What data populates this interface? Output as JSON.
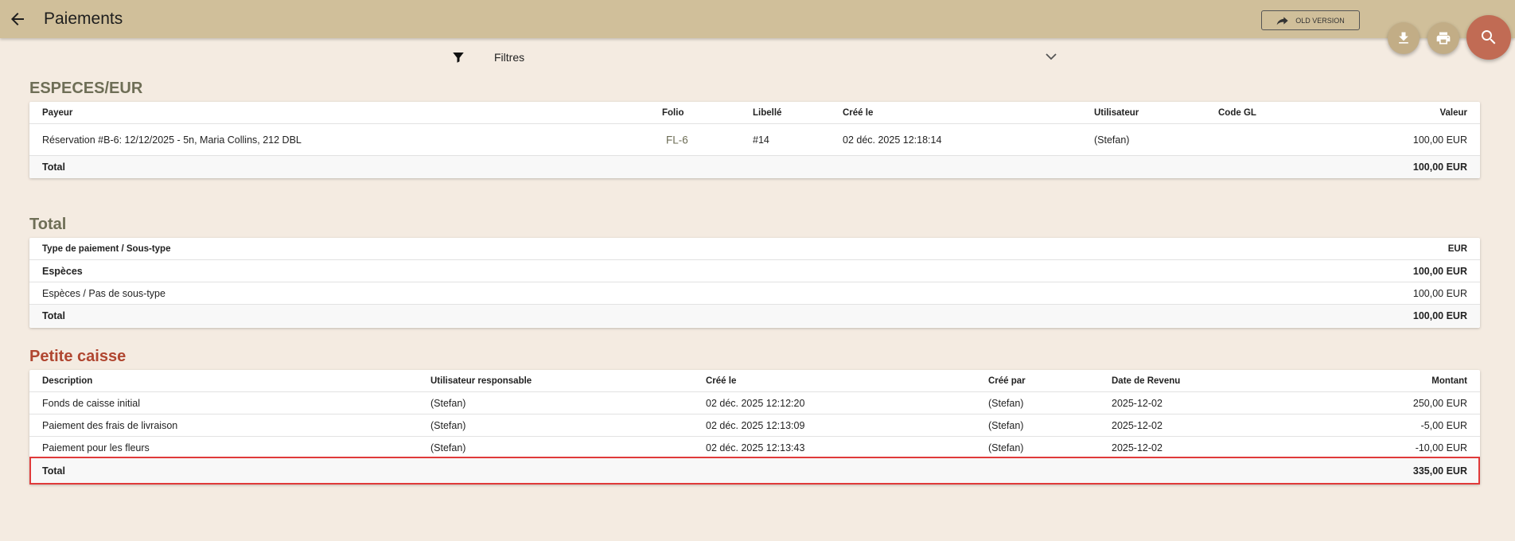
{
  "header": {
    "title": "Paiements",
    "old_version_label": "OLD VERSION"
  },
  "filter": {
    "label": "Filtres"
  },
  "especes_section": {
    "title": "ESPECES/EUR",
    "columns": {
      "payeur": "Payeur",
      "folio": "Folio",
      "libelle": "Libellé",
      "cree_le": "Créé le",
      "utilisateur": "Utilisateur",
      "code_gl": "Code GL",
      "valeur": "Valeur"
    },
    "rows": [
      {
        "payeur": "Réservation #B-6: 12/12/2025 - 5n, Maria Collins, 212 DBL",
        "folio": "FL-6",
        "libelle": "#14",
        "cree_le": "02 déc. 2025 12:18:14",
        "utilisateur": "(Stefan)",
        "code_gl": "",
        "valeur": "100,00 EUR"
      }
    ],
    "total_label": "Total",
    "total_value": "100,00 EUR"
  },
  "total_section": {
    "title": "Total",
    "columns": {
      "type": "Type de paiement / Sous-type",
      "currency": "EUR"
    },
    "rows": [
      {
        "label": "Espèces",
        "value": "100,00 EUR",
        "bold": true
      },
      {
        "label": "Espèces / Pas de sous-type",
        "value": "100,00 EUR",
        "bold": false
      }
    ],
    "total_label": "Total",
    "total_value": "100,00 EUR"
  },
  "petite_caisse": {
    "title": "Petite caisse",
    "columns": {
      "description": "Description",
      "utilisateur": "Utilisateur responsable",
      "cree_le": "Créé le",
      "cree_par": "Créé par",
      "date_revenu": "Date de Revenu",
      "montant": "Montant"
    },
    "rows": [
      {
        "description": "Fonds de caisse initial",
        "utilisateur": "(Stefan)",
        "cree_le": "02 déc. 2025 12:12:20",
        "cree_par": "(Stefan)",
        "date_revenu": "2025-12-02",
        "montant": "250,00 EUR"
      },
      {
        "description": "Paiement des frais de livraison",
        "utilisateur": "(Stefan)",
        "cree_le": "02 déc. 2025 12:13:09",
        "cree_par": "(Stefan)",
        "date_revenu": "2025-12-02",
        "montant": "-5,00 EUR"
      },
      {
        "description": "Paiement pour les fleurs",
        "utilisateur": "(Stefan)",
        "cree_le": "02 déc. 2025 12:13:43",
        "cree_par": "(Stefan)",
        "date_revenu": "2025-12-02",
        "montant": "-10,00 EUR"
      }
    ],
    "total_label": "Total",
    "total_value": "335,00 EUR"
  },
  "colors": {
    "topbar": "#d0bf9a",
    "background": "#f4ebe1",
    "fab_small": "#c2ad86",
    "fab_search": "#c16b54",
    "section_olive": "#6e6e56",
    "section_red": "#b04630",
    "highlight_border": "#e03a3a"
  },
  "icons": {
    "back": "arrow-left-icon",
    "old_version": "share-arrow-icon",
    "download": "download-icon",
    "print": "printer-icon",
    "search": "search-icon",
    "filter": "filter-funnel-icon",
    "chevron": "chevron-down-icon"
  }
}
